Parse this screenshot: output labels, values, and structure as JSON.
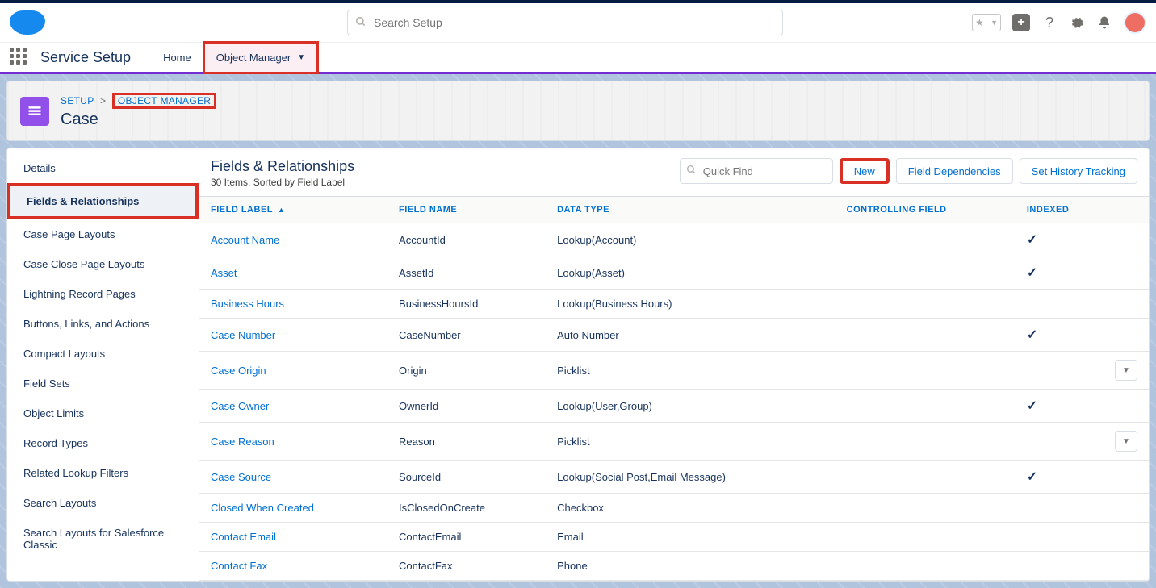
{
  "header": {
    "search_placeholder": "Search Setup"
  },
  "context": {
    "app_name": "Service Setup",
    "nav_home": "Home",
    "nav_object_manager": "Object Manager"
  },
  "breadcrumb": {
    "setup": "SETUP",
    "object_manager": "OBJECT MANAGER",
    "object_title": "Case"
  },
  "sidebar": {
    "items": [
      "Details",
      "Fields & Relationships",
      "Case Page Layouts",
      "Case Close Page Layouts",
      "Lightning Record Pages",
      "Buttons, Links, and Actions",
      "Compact Layouts",
      "Field Sets",
      "Object Limits",
      "Record Types",
      "Related Lookup Filters",
      "Search Layouts",
      "Search Layouts for Salesforce Classic"
    ]
  },
  "content": {
    "title": "Fields & Relationships",
    "subtitle": "30 Items, Sorted by Field Label",
    "quick_find_placeholder": "Quick Find",
    "btn_new": "New",
    "btn_field_deps": "Field Dependencies",
    "btn_history": "Set History Tracking",
    "columns": {
      "label": "FIELD LABEL",
      "name": "FIELD NAME",
      "type": "DATA TYPE",
      "controlling": "CONTROLLING FIELD",
      "indexed": "INDEXED"
    },
    "rows": [
      {
        "label": "Account Name",
        "name": "AccountId",
        "type": "Lookup(Account)",
        "indexed": true,
        "menu": false
      },
      {
        "label": "Asset",
        "name": "AssetId",
        "type": "Lookup(Asset)",
        "indexed": true,
        "menu": false
      },
      {
        "label": "Business Hours",
        "name": "BusinessHoursId",
        "type": "Lookup(Business Hours)",
        "indexed": false,
        "menu": false
      },
      {
        "label": "Case Number",
        "name": "CaseNumber",
        "type": "Auto Number",
        "indexed": true,
        "menu": false
      },
      {
        "label": "Case Origin",
        "name": "Origin",
        "type": "Picklist",
        "indexed": false,
        "menu": true
      },
      {
        "label": "Case Owner",
        "name": "OwnerId",
        "type": "Lookup(User,Group)",
        "indexed": true,
        "menu": false
      },
      {
        "label": "Case Reason",
        "name": "Reason",
        "type": "Picklist",
        "indexed": false,
        "menu": true
      },
      {
        "label": "Case Source",
        "name": "SourceId",
        "type": "Lookup(Social Post,Email Message)",
        "indexed": true,
        "menu": false
      },
      {
        "label": "Closed When Created",
        "name": "IsClosedOnCreate",
        "type": "Checkbox",
        "indexed": false,
        "menu": false
      },
      {
        "label": "Contact Email",
        "name": "ContactEmail",
        "type": "Email",
        "indexed": false,
        "menu": false
      },
      {
        "label": "Contact Fax",
        "name": "ContactFax",
        "type": "Phone",
        "indexed": false,
        "menu": false
      }
    ]
  }
}
